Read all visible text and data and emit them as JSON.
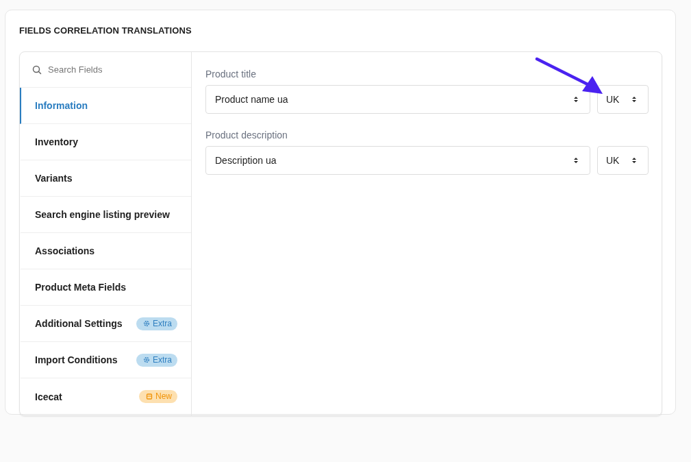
{
  "title": "FIELDS CORRELATION TRANSLATIONS",
  "search": {
    "placeholder": "Search Fields"
  },
  "sidebar": {
    "items": [
      {
        "label": "Information",
        "selected": true
      },
      {
        "label": "Inventory",
        "selected": false
      },
      {
        "label": "Variants",
        "selected": false
      },
      {
        "label": "Search engine listing preview",
        "selected": false
      },
      {
        "label": "Associations",
        "selected": false
      },
      {
        "label": "Product Meta Fields",
        "selected": false
      },
      {
        "label": "Additional Settings",
        "selected": false,
        "badge": {
          "kind": "extra",
          "text": "Extra"
        }
      },
      {
        "label": "Import Conditions",
        "selected": false,
        "badge": {
          "kind": "extra",
          "text": "Extra"
        }
      },
      {
        "label": "Icecat",
        "selected": false,
        "badge": {
          "kind": "new",
          "text": "New"
        }
      }
    ]
  },
  "fields": [
    {
      "label": "Product title",
      "value": "Product name ua",
      "language": "UK"
    },
    {
      "label": "Product description",
      "value": "Description ua",
      "language": "UK"
    }
  ]
}
